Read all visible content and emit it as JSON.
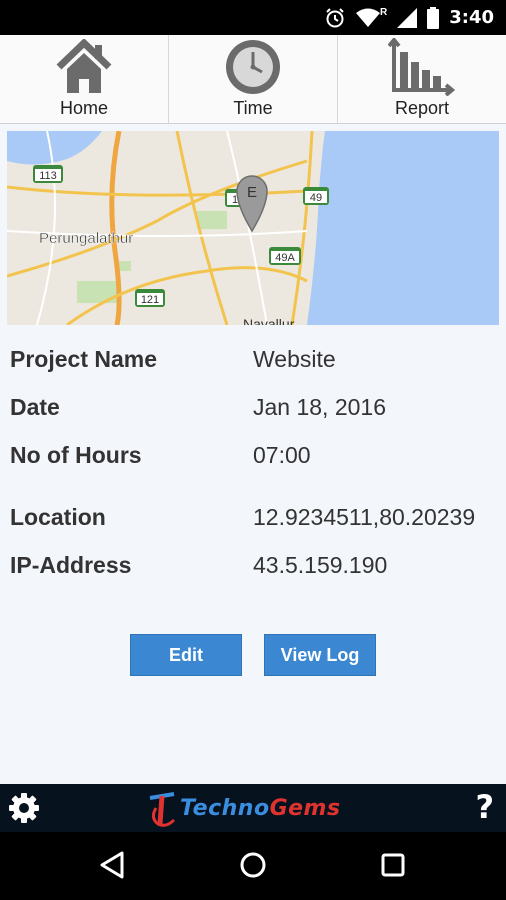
{
  "status_bar": {
    "time": "3:40",
    "signal_tag": "R"
  },
  "nav": {
    "items": [
      {
        "label": "Home",
        "icon": "home-icon"
      },
      {
        "label": "Time",
        "icon": "clock-icon"
      },
      {
        "label": "Report",
        "icon": "bar-chart-icon"
      }
    ]
  },
  "map": {
    "place_label": "Perungalathur",
    "marker_letter": "E",
    "highways": [
      "113",
      "121",
      "49",
      "49A",
      "1"
    ],
    "bottom_label": "Navallur"
  },
  "details": {
    "rows": [
      {
        "label": "Project Name",
        "value": "Website"
      },
      {
        "label": "Date",
        "value": "Jan 18, 2016"
      },
      {
        "label": "No of Hours",
        "value": "07:00"
      },
      {
        "label": "Location",
        "value": "12.9234511,80.20239"
      },
      {
        "label": "IP-Address",
        "value": "43.5.159.190"
      }
    ]
  },
  "actions": {
    "edit_label": "Edit",
    "view_log_label": "View Log"
  },
  "footer": {
    "brand_part1": "Techno",
    "brand_part2": "Gems",
    "help_label": "?"
  },
  "colors": {
    "button_blue": "#3b87d1",
    "footer_bg": "#07121f",
    "content_bg": "#f3f6fb"
  }
}
